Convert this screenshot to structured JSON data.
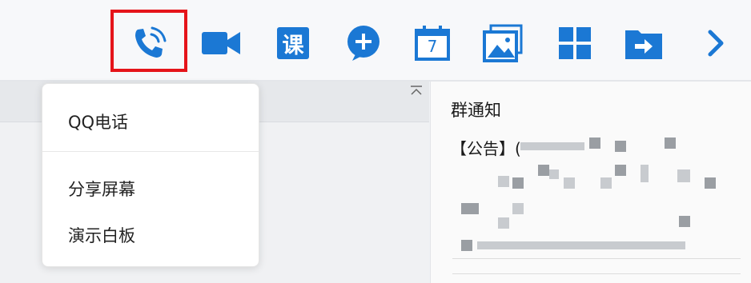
{
  "toolbar": {
    "icons": [
      "phone-call-icon",
      "video-camera-icon",
      "course-icon",
      "add-circle-icon",
      "calendar-icon",
      "image-gallery-icon",
      "apps-grid-icon",
      "folder-share-icon",
      "chevron-right-icon"
    ],
    "course_glyph": "课",
    "calendar_day": "7",
    "accent": "#1b78d4",
    "highlight_color": "#e5141a"
  },
  "call_menu": {
    "items": [
      "QQ电话",
      "分享屏幕",
      "演示白板"
    ]
  },
  "group_notice": {
    "title": "群通知",
    "announcement_prefix": "【公告】("
  }
}
